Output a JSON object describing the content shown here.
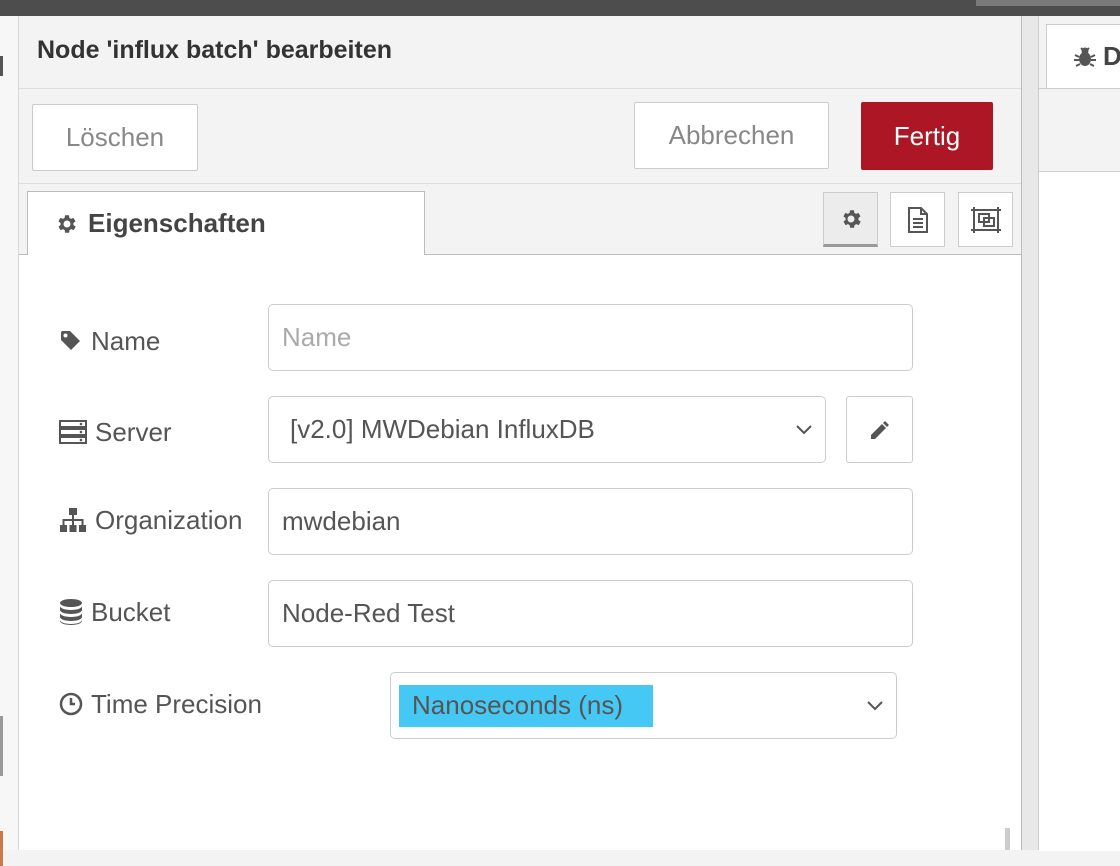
{
  "tray": {
    "title": "Node 'influx batch' bearbeiten",
    "buttons": {
      "delete": "Löschen",
      "cancel": "Abbrechen",
      "done": "Fertig"
    },
    "tabs": {
      "properties": "Eigenschaften",
      "icons": [
        "gear-icon",
        "document-icon",
        "frame-icon"
      ]
    }
  },
  "form": {
    "name": {
      "label": "Name",
      "value": "",
      "placeholder": "Name"
    },
    "server": {
      "label": "Server",
      "value": "[v2.0] MWDebian InfluxDB"
    },
    "organization": {
      "label": "Organization",
      "value": "mwdebian"
    },
    "bucket": {
      "label": "Bucket",
      "value": "Node-Red Test"
    },
    "time_precision": {
      "label": "Time Precision",
      "value": "Nanoseconds (ns)"
    }
  },
  "right_panel": {
    "tab_label": "D",
    "tab_icon": "bug-icon"
  },
  "colors": {
    "done_button": "#ad1625",
    "selection_highlight": "#46c8f4"
  }
}
